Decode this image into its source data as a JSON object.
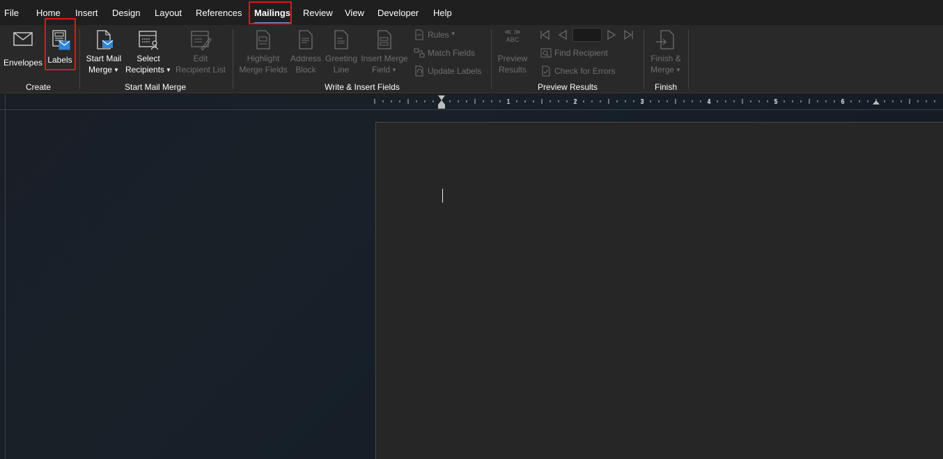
{
  "tabs": [
    {
      "id": "file",
      "label": "File"
    },
    {
      "id": "home",
      "label": "Home"
    },
    {
      "id": "insert",
      "label": "Insert"
    },
    {
      "id": "design",
      "label": "Design"
    },
    {
      "id": "layout",
      "label": "Layout"
    },
    {
      "id": "references",
      "label": "References"
    },
    {
      "id": "mailings",
      "label": "Mailings"
    },
    {
      "id": "review",
      "label": "Review"
    },
    {
      "id": "view",
      "label": "View"
    },
    {
      "id": "developer",
      "label": "Developer"
    },
    {
      "id": "help",
      "label": "Help"
    }
  ],
  "active_tab": "Mailings",
  "ribbon": {
    "create": {
      "group_label": "Create",
      "envelopes": "Envelopes",
      "labels": "Labels"
    },
    "start_mail_merge": {
      "group_label": "Start Mail Merge",
      "start_mail_merge_line1": "Start Mail",
      "start_mail_merge_line2": "Merge",
      "select_recipients_line1": "Select",
      "select_recipients_line2": "Recipients",
      "edit_recipient_list_line1": "Edit",
      "edit_recipient_list_line2": "Recipient List"
    },
    "write_insert_fields": {
      "group_label": "Write & Insert Fields",
      "highlight_line1": "Highlight",
      "highlight_line2": "Merge Fields",
      "address_line1": "Address",
      "address_line2": "Block",
      "greeting_line1": "Greeting",
      "greeting_line2": "Line",
      "insert_merge_line1": "Insert Merge",
      "insert_merge_line2": "Field",
      "rules": "Rules",
      "match_fields": "Match Fields",
      "update_labels": "Update Labels"
    },
    "preview_results": {
      "group_label": "Preview Results",
      "abc_icon_text": "ABC",
      "preview_line1": "Preview",
      "preview_line2": "Results",
      "find_recipient": "Find Recipient",
      "check_for_errors": "Check for Errors",
      "record_value": ""
    },
    "finish": {
      "group_label": "Finish",
      "finish_line1": "Finish &",
      "finish_line2": "Merge"
    }
  },
  "ruler": {
    "numbers": [
      "1",
      "2",
      "3",
      "4",
      "5",
      "6"
    ]
  },
  "colors": {
    "highlight_box": "#e5141c",
    "tab_underline": "#6ea6e8",
    "disabled_text": "#6f6f6f",
    "ribbon_bg": "#292929",
    "page_bg": "#262626"
  }
}
